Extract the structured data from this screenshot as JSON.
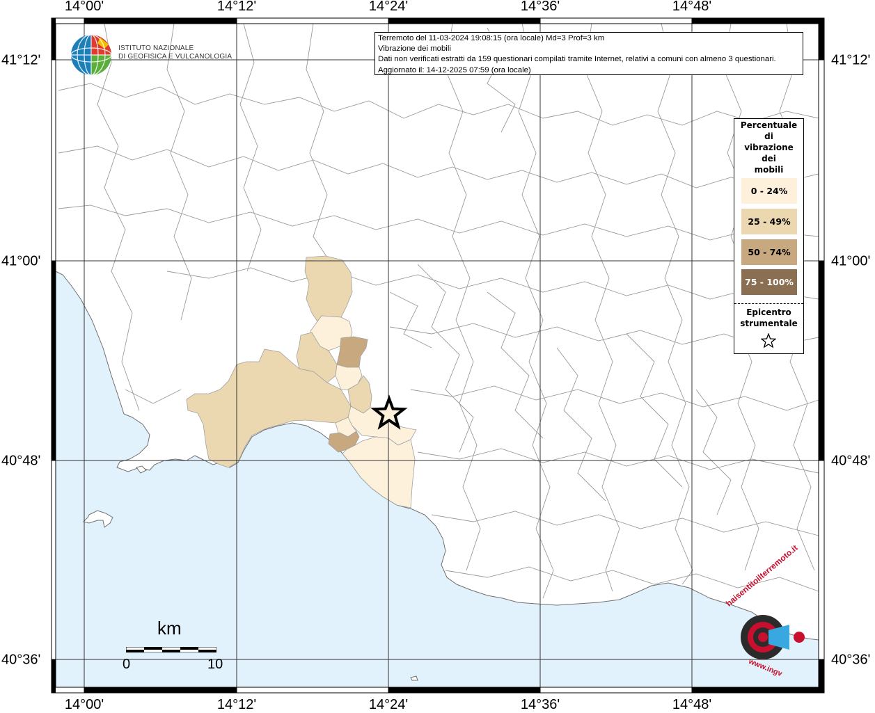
{
  "map": {
    "lon_labels": [
      "14°00'",
      "14°12'",
      "14°24'",
      "14°36'",
      "14°48'"
    ],
    "lat_labels": [
      "41°12'",
      "41°00'",
      "40°48'",
      "40°36'"
    ],
    "colors": {
      "sea": "#e1f2fd",
      "land": "#ffffff",
      "borders": "#9a9a9a",
      "frame": "#000000"
    }
  },
  "info_box": {
    "line1": "Terremoto del 11-03-2024 19:08:15 (ora locale) Md=3 Prof=3 km",
    "line2": "Vibrazione dei mobili",
    "line3": "Dati non verificati estratti da 159 questionari compilati tramite Internet, relativi a comuni con almeno 3 questionari.",
    "line4": "Aggiornato il: 14-12-2025 07:59 (ora locale)"
  },
  "logo": {
    "line1": "ISTITUTO NAZIONALE",
    "line2": "DI GEOFISICA E VULCANOLOGIA"
  },
  "legend": {
    "title_lines": [
      "Percentuale",
      "di",
      "vibrazione",
      "dei",
      "mobili"
    ],
    "classes": [
      {
        "label": "0 - 24%",
        "color": "#fdf1dc"
      },
      {
        "label": "25 - 49%",
        "color": "#ecd8b0"
      },
      {
        "label": "50 - 74%",
        "color": "#c8a87e"
      },
      {
        "label": "75 - 100%",
        "color": "#8b6f52"
      }
    ],
    "epicenter_lines": [
      "Epicentro",
      "strumentale"
    ]
  },
  "scale_bar": {
    "unit": "km",
    "start": "0",
    "end": "10"
  },
  "watermark": {
    "brand": "haisentitoilterremoto.it",
    "url": "www.ingv"
  }
}
